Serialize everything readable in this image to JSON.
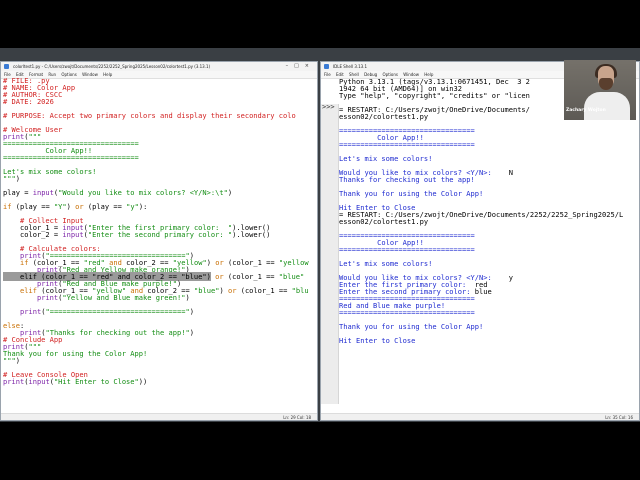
{
  "editor": {
    "title": "colorltest1.py - C:/Users/zwojt/Documents/2252/2252_Spring2025/Lesson02/colortest1.py (3.13.1)",
    "menu": [
      "File",
      "Edit",
      "Format",
      "Run",
      "Options",
      "Window",
      "Help"
    ],
    "status": "Ln: 29   Col: 18",
    "lines": [
      [
        [
          "c-com",
          "# FILE: .py"
        ]
      ],
      [
        [
          "c-com",
          "# NAME: Color App"
        ]
      ],
      [
        [
          "c-com",
          "# AUTHOR: CSCC"
        ]
      ],
      [
        [
          "c-com",
          "# DATE: 2026"
        ]
      ],
      [],
      [
        [
          "c-com",
          "# PURPOSE: Accept two primary colors and display their secondary colo"
        ]
      ],
      [],
      [
        [
          "c-com",
          "# Welcome User"
        ]
      ],
      [
        [
          "c-bi",
          "print"
        ],
        [
          "c-plain",
          "("
        ],
        [
          "c-str",
          "\"\"\""
        ]
      ],
      [
        [
          "c-str",
          "================================"
        ]
      ],
      [
        [
          "c-str",
          "          Color App!!"
        ]
      ],
      [
        [
          "c-str",
          "================================"
        ]
      ],
      [],
      [
        [
          "c-str",
          "Let's mix some colors!"
        ]
      ],
      [
        [
          "c-str",
          "\"\"\""
        ],
        [
          "c-plain",
          ")"
        ]
      ],
      [],
      [
        [
          "c-plain",
          "play = "
        ],
        [
          "c-bi",
          "input"
        ],
        [
          "c-plain",
          "("
        ],
        [
          "c-str",
          "\"Would you like to mix colors? <Y/N>:\\t\""
        ],
        [
          "c-plain",
          ")"
        ]
      ],
      [],
      [
        [
          "c-kw",
          "if"
        ],
        [
          "c-plain",
          " (play == "
        ],
        [
          "c-str",
          "\"Y\""
        ],
        [
          "c-plain",
          ") "
        ],
        [
          "c-kw",
          "or"
        ],
        [
          "c-plain",
          " (play == "
        ],
        [
          "c-str",
          "\"y\""
        ],
        [
          "c-plain",
          "):"
        ]
      ],
      [],
      [
        [
          "c-com",
          "    # Collect Input"
        ]
      ],
      [
        [
          "c-plain",
          "    color_1 = "
        ],
        [
          "c-bi",
          "input"
        ],
        [
          "c-plain",
          "("
        ],
        [
          "c-str",
          "\"Enter the first primary color:  \""
        ],
        [
          "c-plain",
          ").lower()"
        ]
      ],
      [
        [
          "c-plain",
          "    color_2 = "
        ],
        [
          "c-bi",
          "input"
        ],
        [
          "c-plain",
          "("
        ],
        [
          "c-str",
          "\"Enter the second primary color: \""
        ],
        [
          "c-plain",
          ").lower()"
        ]
      ],
      [],
      [
        [
          "c-com",
          "    # Calculate colors:"
        ]
      ],
      [
        [
          "c-plain",
          "    "
        ],
        [
          "c-bi",
          "print"
        ],
        [
          "c-plain",
          "("
        ],
        [
          "c-str",
          "\"================================\""
        ],
        [
          "c-plain",
          ")"
        ]
      ],
      [
        [
          "c-plain",
          "    "
        ],
        [
          "c-kw",
          "if"
        ],
        [
          "c-plain",
          " (color_1 == "
        ],
        [
          "c-str",
          "\"red\""
        ],
        [
          "c-plain",
          " "
        ],
        [
          "c-kw",
          "and"
        ],
        [
          "c-plain",
          " color_2 == "
        ],
        [
          "c-str",
          "\"yellow\""
        ],
        [
          "c-plain",
          ") "
        ],
        [
          "c-kw",
          "or"
        ],
        [
          "c-plain",
          " (color_1 == "
        ],
        [
          "c-str",
          "\"yellow"
        ]
      ],
      [
        [
          "c-plain",
          "        "
        ],
        [
          "c-bi",
          "print"
        ],
        [
          "c-plain",
          "("
        ],
        [
          "c-str",
          "\"Red and Yellow make orange!\""
        ],
        [
          "c-plain",
          ")"
        ]
      ],
      [
        [
          "hl",
          "    elif (color_1 == \"red\" and color_2 == \"blue\")"
        ],
        [
          "c-plain",
          " "
        ],
        [
          "c-kw",
          "or"
        ],
        [
          "c-plain",
          " (color_1 == "
        ],
        [
          "c-str",
          "\"blue\""
        ]
      ],
      [
        [
          "c-plain",
          "        "
        ],
        [
          "c-bi",
          "print"
        ],
        [
          "c-plain",
          "("
        ],
        [
          "c-str",
          "\"Red and Blue make purple!\""
        ],
        [
          "c-plain",
          ")"
        ]
      ],
      [
        [
          "c-plain",
          "    "
        ],
        [
          "c-kw",
          "elif"
        ],
        [
          "c-plain",
          " (color_1 == "
        ],
        [
          "c-str",
          "\"yellow\""
        ],
        [
          "c-plain",
          " "
        ],
        [
          "c-kw",
          "and"
        ],
        [
          "c-plain",
          " color_2 == "
        ],
        [
          "c-str",
          "\"blue\""
        ],
        [
          "c-plain",
          ") "
        ],
        [
          "c-kw",
          "or"
        ],
        [
          "c-plain",
          " (color_1 == "
        ],
        [
          "c-str",
          "\"blu"
        ]
      ],
      [
        [
          "c-plain",
          "        "
        ],
        [
          "c-bi",
          "print"
        ],
        [
          "c-plain",
          "("
        ],
        [
          "c-str",
          "\"Yellow and Blue make green!\""
        ],
        [
          "c-plain",
          ")"
        ]
      ],
      [],
      [
        [
          "c-plain",
          "    "
        ],
        [
          "c-bi",
          "print"
        ],
        [
          "c-plain",
          "("
        ],
        [
          "c-str",
          "\"================================\""
        ],
        [
          "c-plain",
          ")"
        ]
      ],
      [],
      [
        [
          "c-kw",
          "else"
        ],
        [
          "c-plain",
          ":"
        ]
      ],
      [
        [
          "c-plain",
          "    "
        ],
        [
          "c-bi",
          "print"
        ],
        [
          "c-plain",
          "("
        ],
        [
          "c-str",
          "\"Thanks for checking out the app!\""
        ],
        [
          "c-plain",
          ")"
        ]
      ],
      [
        [
          "c-com",
          "# Conclude App"
        ]
      ],
      [
        [
          "c-bi",
          "print"
        ],
        [
          "c-plain",
          "("
        ],
        [
          "c-str",
          "\"\"\""
        ]
      ],
      [
        [
          "c-str",
          "Thank you for using the Color App!"
        ]
      ],
      [
        [
          "c-str",
          "\"\"\""
        ],
        [
          "c-plain",
          ")"
        ]
      ],
      [],
      [
        [
          "c-com",
          "# Leave Console Open"
        ]
      ],
      [
        [
          "c-bi",
          "print"
        ],
        [
          "c-plain",
          "("
        ],
        [
          "c-bi",
          "input"
        ],
        [
          "c-plain",
          "("
        ],
        [
          "c-str",
          "\"Hit Enter to Close\""
        ],
        [
          "c-plain",
          "))"
        ]
      ]
    ]
  },
  "shell": {
    "title": "IDLE Shell 3.13.1",
    "menu": [
      "File",
      "Edit",
      "Shell",
      "Debug",
      "Options",
      "Window",
      "Help"
    ],
    "status": "Ln: 35   Col: 16",
    "prompt": ">>>",
    "lines": [
      [
        [
          "c-plain",
          "Python 3.13.1 (tags/v3.13.1:0671451, Dec  3 2"
        ]
      ],
      [
        [
          "c-plain",
          "1942 64 bit (AMD64)] on win32"
        ]
      ],
      [
        [
          "c-plain",
          "Type \"help\", \"copyright\", \"credits\" or \"licen"
        ]
      ],
      [
        [
          "c-plain",
          "    "
        ]
      ],
      [
        [
          "c-plain",
          "= RESTART: C:/Users/zwojt/OneDrive/Documents/"
        ]
      ],
      [
        [
          "c-plain",
          "esson02/colortest1.py"
        ]
      ],
      [],
      [
        [
          "c-blue",
          "================================"
        ]
      ],
      [
        [
          "c-blue",
          "         Color App!!"
        ]
      ],
      [
        [
          "c-blue",
          "================================"
        ]
      ],
      [],
      [
        [
          "c-blue",
          "Let's mix some colors!"
        ]
      ],
      [],
      [
        [
          "c-blue",
          "Would you like to mix colors? <Y/N>:"
        ],
        [
          "c-plain",
          "    N"
        ]
      ],
      [
        [
          "c-blue",
          "Thanks for checking out the app!"
        ]
      ],
      [],
      [
        [
          "c-blue",
          "Thank you for using the Color App!"
        ]
      ],
      [],
      [
        [
          "c-blue",
          "Hit Enter to Close"
        ]
      ],
      [
        [
          "c-plain",
          "= RESTART: C:/Users/zwojt/OneDrive/Documents/2252/2252_Spring2025/L"
        ]
      ],
      [
        [
          "c-plain",
          "esson02/colortest1.py"
        ]
      ],
      [],
      [
        [
          "c-blue",
          "================================"
        ]
      ],
      [
        [
          "c-blue",
          "         Color App!!"
        ]
      ],
      [
        [
          "c-blue",
          "================================"
        ]
      ],
      [],
      [
        [
          "c-blue",
          "Let's mix some colors!"
        ]
      ],
      [],
      [
        [
          "c-blue",
          "Would you like to mix colors? <Y/N>:"
        ],
        [
          "c-plain",
          "    y"
        ]
      ],
      [
        [
          "c-blue",
          "Enter the first primary color:"
        ],
        [
          "c-plain",
          "  red"
        ]
      ],
      [
        [
          "c-blue",
          "Enter the second primary color:"
        ],
        [
          "c-plain",
          " blue"
        ]
      ],
      [
        [
          "c-blue",
          "================================"
        ]
      ],
      [
        [
          "c-blue",
          "Red and Blue make purple!"
        ]
      ],
      [
        [
          "c-blue",
          "================================"
        ]
      ],
      [],
      [
        [
          "c-blue",
          "Thank you for using the Color App!"
        ]
      ],
      [],
      [
        [
          "c-blue",
          "Hit Enter to Close"
        ]
      ]
    ]
  },
  "webcam": {
    "name": "Zachary Wojton"
  }
}
